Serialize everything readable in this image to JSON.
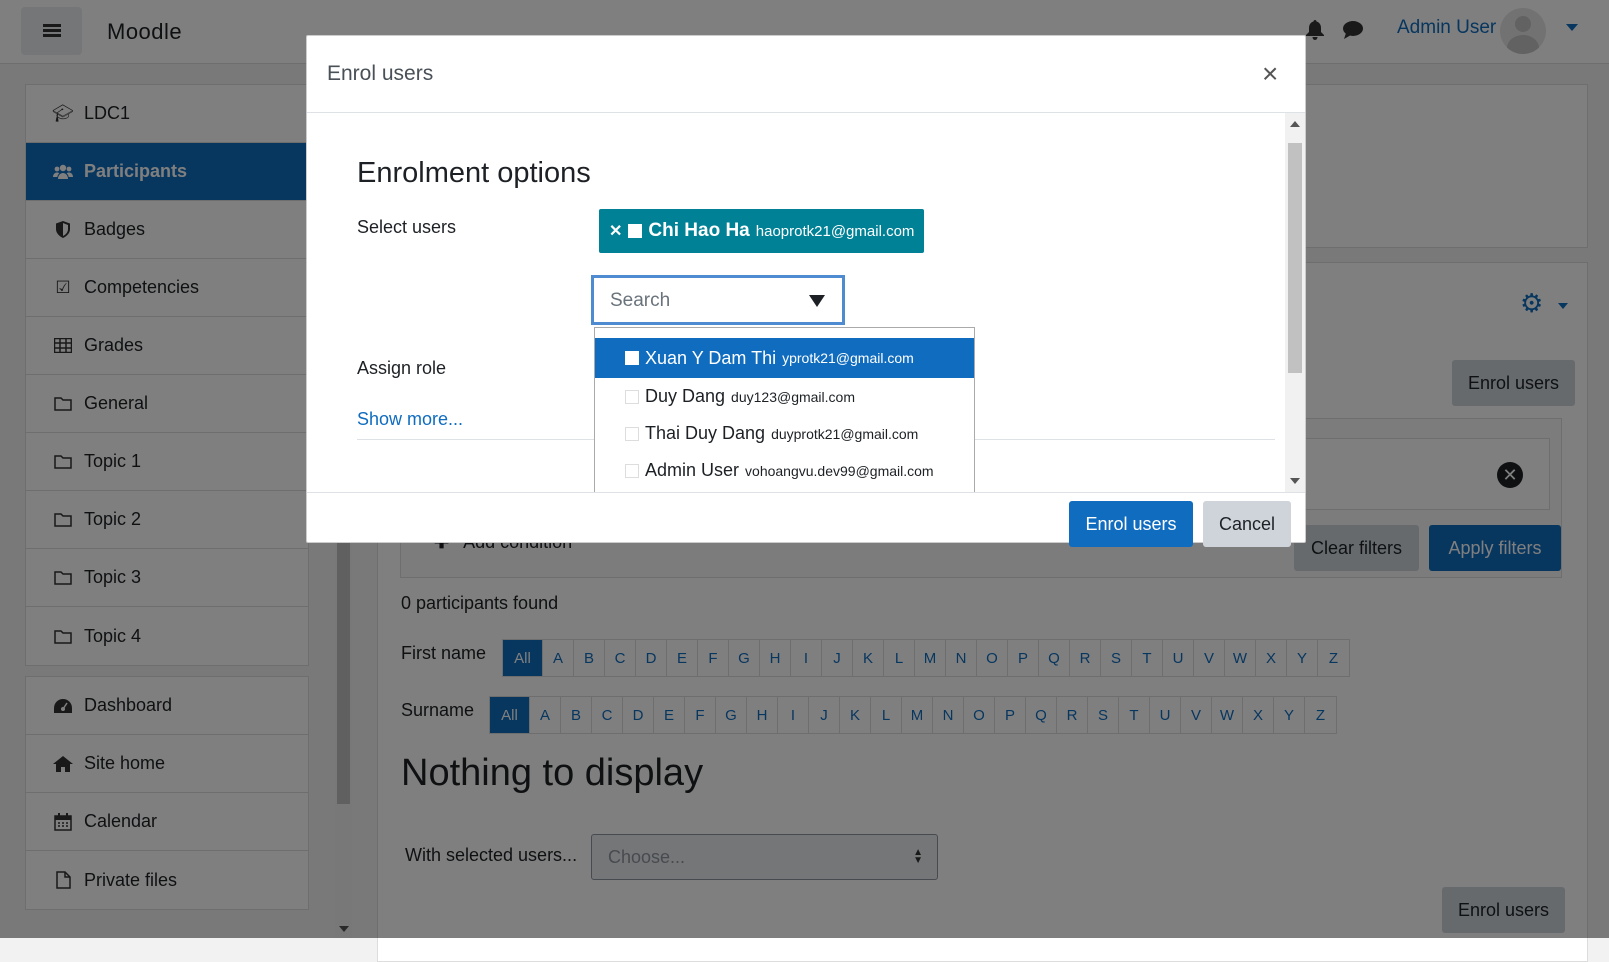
{
  "navbar": {
    "brand": "Moodle",
    "user_name": "Admin User",
    "icons": [
      "menu-icon",
      "bell-icon",
      "chat-icon",
      "avatar",
      "chevron-down-icon"
    ]
  },
  "drawer": {
    "course_items": [
      {
        "label": "LDC1",
        "icon": "graduation-cap-icon"
      },
      {
        "label": "Participants",
        "icon": "users-icon",
        "active": true
      },
      {
        "label": "Badges",
        "icon": "shield-icon"
      },
      {
        "label": "Competencies",
        "icon": "checkbox-icon"
      },
      {
        "label": "Grades",
        "icon": "table-icon"
      },
      {
        "label": "General",
        "icon": "folder-icon"
      },
      {
        "label": "Topic 1",
        "icon": "folder-icon"
      },
      {
        "label": "Topic 2",
        "icon": "folder-icon"
      },
      {
        "label": "Topic 3",
        "icon": "folder-icon"
      },
      {
        "label": "Topic 4",
        "icon": "folder-icon"
      }
    ],
    "site_items": [
      {
        "label": "Dashboard",
        "icon": "dashboard-icon"
      },
      {
        "label": "Site home",
        "icon": "home-icon"
      },
      {
        "label": "Calendar",
        "icon": "calendar-icon"
      },
      {
        "label": "Private files",
        "icon": "file-icon"
      }
    ]
  },
  "main": {
    "enrol_button_top": "Enrol users",
    "add_condition": "Add condition",
    "clear_filters": "Clear filters",
    "apply_filters": "Apply filters",
    "found": "0 participants found",
    "first_name_label": "First name",
    "surname_label": "Surname",
    "initials_all": "All",
    "letters": [
      "A",
      "B",
      "C",
      "D",
      "E",
      "F",
      "G",
      "H",
      "I",
      "J",
      "K",
      "L",
      "M",
      "N",
      "O",
      "P",
      "Q",
      "R",
      "S",
      "T",
      "U",
      "V",
      "W",
      "X",
      "Y",
      "Z"
    ],
    "nothing": "Nothing to display",
    "with_selected_label": "With selected users...",
    "with_selected_value": "Choose...",
    "enrol_button_bottom": "Enrol users"
  },
  "modal": {
    "title": "Enrol users",
    "section_title": "Enrolment options",
    "select_users_label": "Select users",
    "selected_user": {
      "name": "Chi Hao Ha",
      "email": "haoprotk21@gmail.com"
    },
    "search_placeholder": "Search",
    "suggestions": [
      {
        "name": "Xuan Y Dam Thi",
        "email": "yprotk21@gmail.com",
        "active": true
      },
      {
        "name": "Duy Dang",
        "email": "duy123@gmail.com"
      },
      {
        "name": "Thai Duy Dang",
        "email": "duyprotk21@gmail.com"
      },
      {
        "name": "Admin User",
        "email": "vohoangvu.dev99@gmail.com"
      }
    ],
    "assign_role_label": "Assign role",
    "show_more": "Show more...",
    "enrol_button": "Enrol users",
    "cancel_button": "Cancel"
  },
  "colors": {
    "primary": "#0f6cbf",
    "chip": "#008196",
    "secondary_button": "#ced4da",
    "overlay": "rgba(0,0,0,0.5)"
  }
}
